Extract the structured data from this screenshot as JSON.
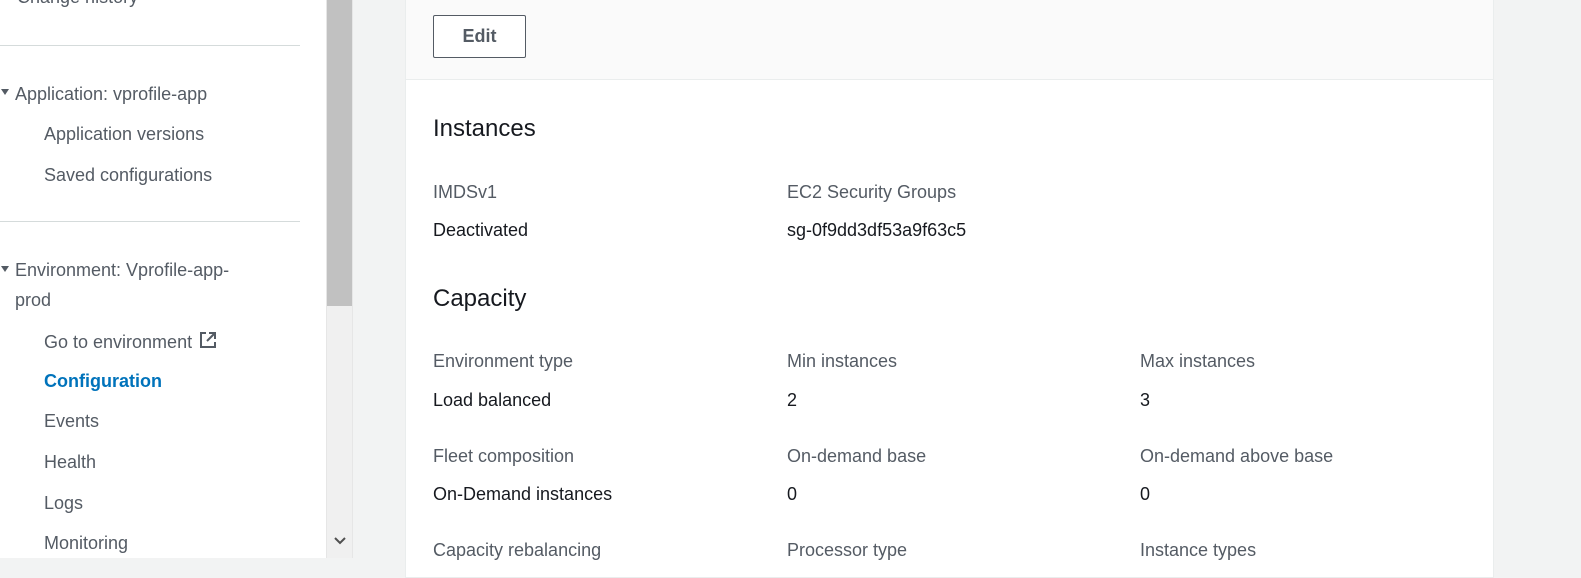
{
  "sidebar": {
    "change_history": "Change history",
    "application_section": "Application: vprofile-app",
    "application_items": [
      "Application versions",
      "Saved configurations"
    ],
    "environment_section": "Environment: Vprofile-app-prod",
    "environment_section_line1": "Environment: Vprofile-app-",
    "environment_section_line2": "prod",
    "go_to_environment": "Go to environment",
    "environment_items": [
      "Configuration",
      "Events",
      "Health",
      "Logs",
      "Monitoring"
    ],
    "active_item": "Configuration"
  },
  "main": {
    "edit_label": "Edit",
    "instances": {
      "title": "Instances",
      "fields": [
        {
          "label": "IMDSv1",
          "value": "Deactivated"
        },
        {
          "label": "EC2 Security Groups",
          "value": "sg-0f9dd3df53a9f63c5"
        }
      ]
    },
    "capacity": {
      "title": "Capacity",
      "fields": [
        {
          "label": "Environment type",
          "value": "Load balanced"
        },
        {
          "label": "Min instances",
          "value": "2"
        },
        {
          "label": "Max instances",
          "value": "3"
        },
        {
          "label": "Fleet composition",
          "value": "On-Demand instances"
        },
        {
          "label": "On-demand base",
          "value": "0"
        },
        {
          "label": "On-demand above base",
          "value": "0"
        },
        {
          "label": "Capacity rebalancing",
          "value": ""
        },
        {
          "label": "Processor type",
          "value": ""
        },
        {
          "label": "Instance types",
          "value": ""
        }
      ]
    }
  },
  "colors": {
    "accent": "#0073bb",
    "sidebar_text": "#545b64",
    "value_text": "#16191f",
    "background": "#f2f3f3"
  }
}
